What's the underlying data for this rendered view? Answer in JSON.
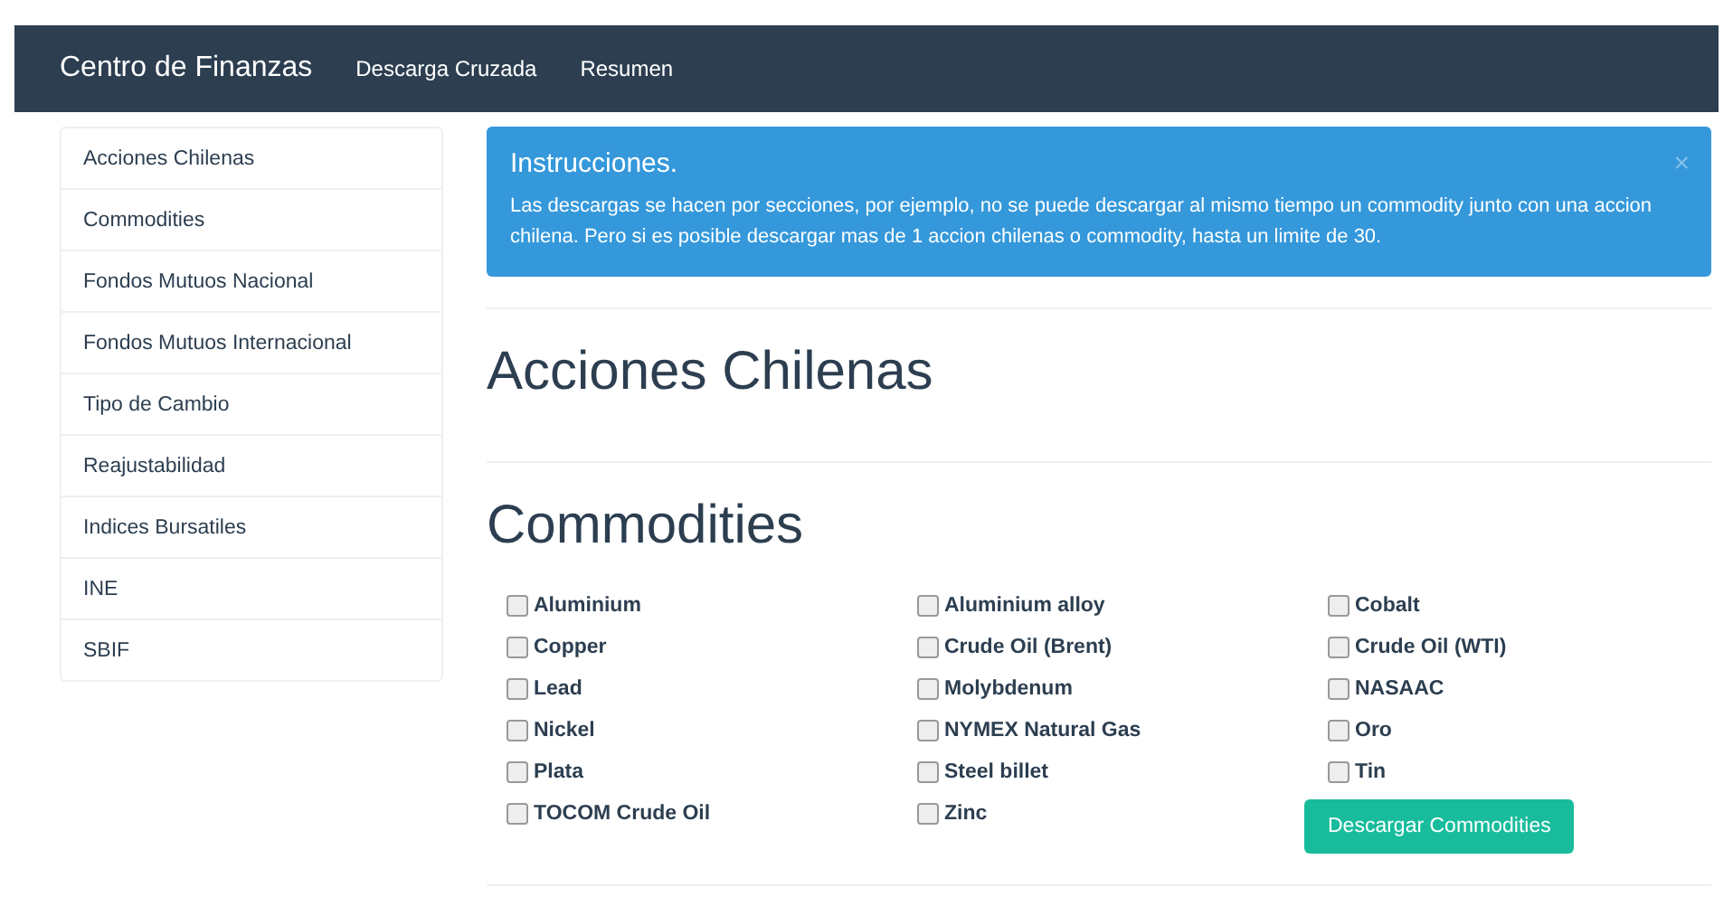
{
  "navbar": {
    "brand": "Centro de Finanzas",
    "links": [
      "Descarga Cruzada",
      "Resumen"
    ]
  },
  "sidebar": {
    "items": [
      {
        "label": "Acciones Chilenas",
        "selected": false
      },
      {
        "label": "Commodities",
        "selected": false
      },
      {
        "label": "Fondos Mutuos Nacional",
        "selected": false
      },
      {
        "label": "Fondos Mutuos Internacional",
        "selected": false
      },
      {
        "label": "Tipo de Cambio",
        "selected": false
      },
      {
        "label": "Reajustabilidad",
        "selected": false
      },
      {
        "label": "Indices Bursatiles",
        "selected": false
      },
      {
        "label": "INE",
        "selected": false
      },
      {
        "label": "SBIF",
        "selected": false
      }
    ]
  },
  "alert": {
    "title": "Instrucciones.",
    "text": "Las descargas se hacen por secciones, por ejemplo, no se puede descargar al mismo tiempo un commodity junto con una accion chilena. Pero si es posible descargar mas de 1 accion chilenas o commodity, hasta un limite de 30.",
    "close": "×"
  },
  "sections": [
    {
      "title": "Acciones Chilenas"
    },
    {
      "title": "Commodities",
      "columns": [
        [
          {
            "label": "Aluminium",
            "checked": false
          },
          {
            "label": "Copper",
            "checked": false
          },
          {
            "label": "Lead",
            "checked": false
          },
          {
            "label": "Nickel",
            "checked": false
          },
          {
            "label": "Plata",
            "checked": false
          },
          {
            "label": "TOCOM Crude Oil",
            "checked": false
          }
        ],
        [
          {
            "label": "Aluminium alloy",
            "checked": false
          },
          {
            "label": "Crude Oil (Brent)",
            "checked": false
          },
          {
            "label": "Molybdenum",
            "checked": false
          },
          {
            "label": "NYMEX Natural Gas",
            "checked": false
          },
          {
            "label": "Steel billet",
            "checked": false
          },
          {
            "label": "Zinc",
            "checked": false
          }
        ],
        [
          {
            "label": "Cobalt",
            "checked": false
          },
          {
            "label": "Crude Oil (WTI)",
            "checked": false
          },
          {
            "label": "NASAAC",
            "checked": false
          },
          {
            "label": "Oro",
            "checked": false
          },
          {
            "label": "Tin",
            "checked": false
          }
        ]
      ],
      "button": "Descargar Commodities"
    }
  ]
}
